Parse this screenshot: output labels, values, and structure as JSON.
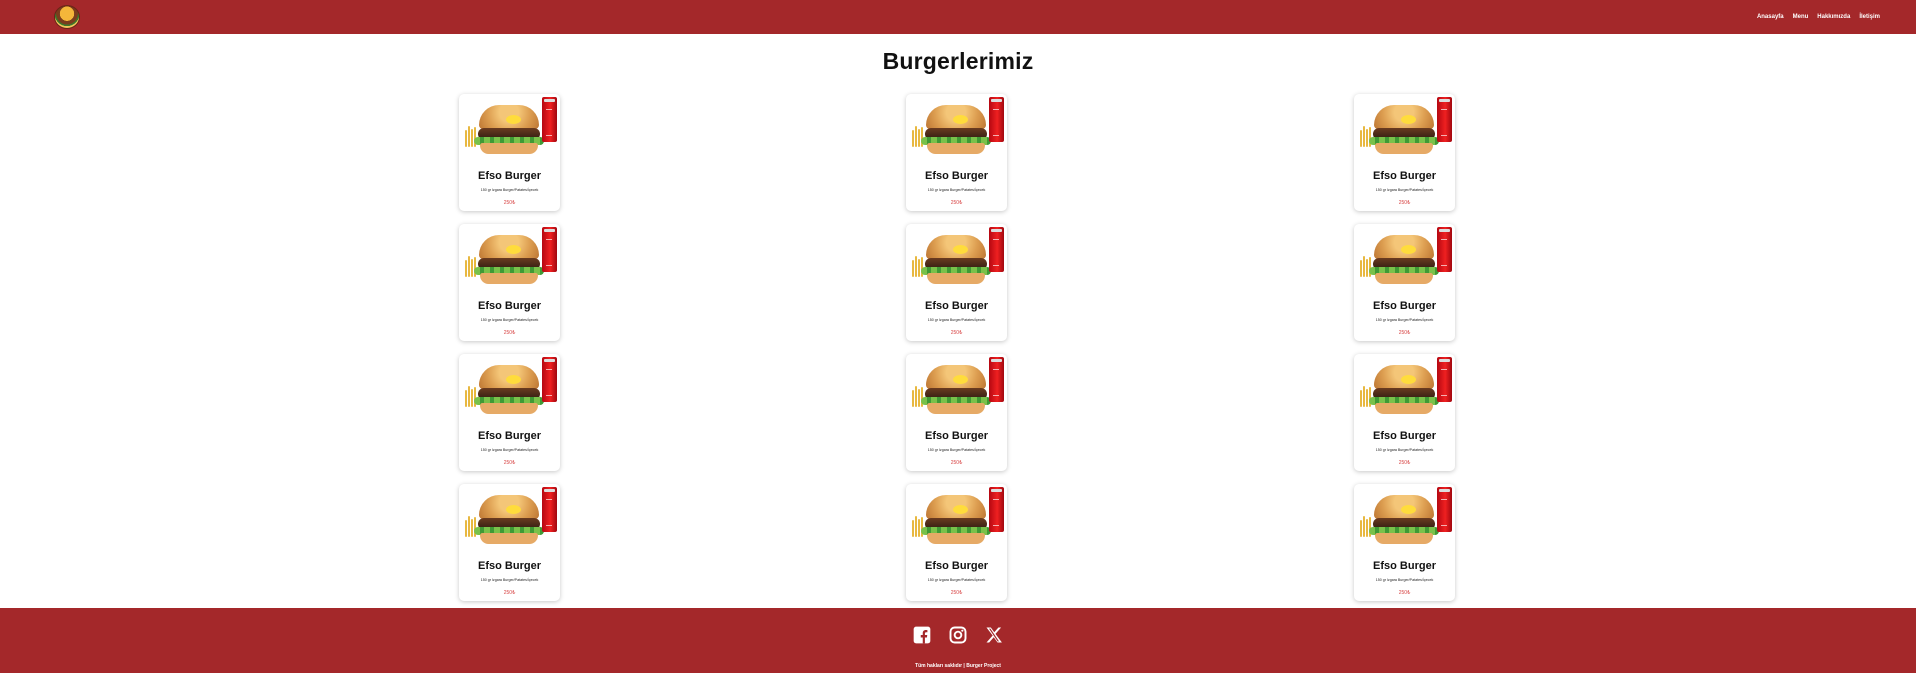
{
  "nav": {
    "logo": "burger-logo",
    "links": [
      "Anasayfa",
      "Menu",
      "Hakkımızda",
      "İletişim"
    ]
  },
  "main": {
    "title": "Burgerlerimiz",
    "cards": [
      {
        "name": "Efso Burger",
        "description": "150 gr Izgara Burger/Patates/İçecek",
        "price": "250₺"
      },
      {
        "name": "Efso Burger",
        "description": "150 gr Izgara Burger/Patates/İçecek",
        "price": "250₺"
      },
      {
        "name": "Efso Burger",
        "description": "150 gr Izgara Burger/Patates/İçecek",
        "price": "250₺"
      },
      {
        "name": "Efso Burger",
        "description": "150 gr Izgara Burger/Patates/İçecek",
        "price": "250₺"
      },
      {
        "name": "Efso Burger",
        "description": "150 gr Izgara Burger/Patates/İçecek",
        "price": "250₺"
      },
      {
        "name": "Efso Burger",
        "description": "150 gr Izgara Burger/Patates/İçecek",
        "price": "250₺"
      },
      {
        "name": "Efso Burger",
        "description": "150 gr Izgara Burger/Patates/İçecek",
        "price": "250₺"
      },
      {
        "name": "Efso Burger",
        "description": "150 gr Izgara Burger/Patates/İçecek",
        "price": "250₺"
      },
      {
        "name": "Efso Burger",
        "description": "150 gr Izgara Burger/Patates/İçecek",
        "price": "250₺"
      },
      {
        "name": "Efso Burger",
        "description": "150 gr Izgara Burger/Patates/İçecek",
        "price": "250₺"
      },
      {
        "name": "Efso Burger",
        "description": "150 gr Izgara Burger/Patates/İçecek",
        "price": "250₺"
      },
      {
        "name": "Efso Burger",
        "description": "150 gr Izgara Burger/Patates/İçecek",
        "price": "250₺"
      }
    ]
  },
  "footer": {
    "social_icons": [
      "facebook-icon",
      "instagram-icon",
      "x-icon"
    ],
    "copyright": "Tüm hakları saklıdır | Burger Project"
  },
  "colors": {
    "header": "#a4282a",
    "footer": "#a4282a",
    "price": "#d84545"
  }
}
